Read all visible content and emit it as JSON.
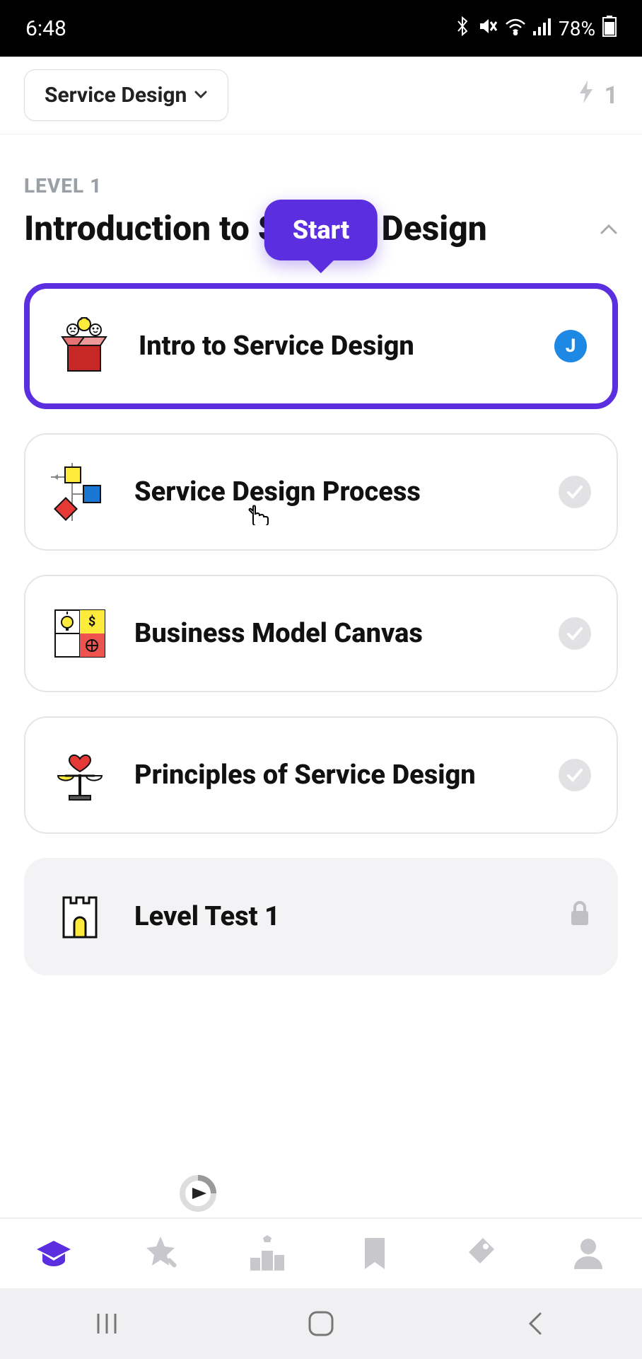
{
  "status": {
    "time": "6:48",
    "battery": "78%"
  },
  "header": {
    "dropdown_label": "Service Design",
    "streak_count": "1"
  },
  "section": {
    "level_label": "LEVEL 1",
    "title": "Introduction to Service Design",
    "start_label": "Start"
  },
  "lessons": [
    {
      "title": "Intro to Service Design",
      "badge": "J"
    },
    {
      "title": "Service Design Process"
    },
    {
      "title": "Business Model Canvas"
    },
    {
      "title": "Principles of Service Design"
    },
    {
      "title": "Level Test 1"
    }
  ]
}
